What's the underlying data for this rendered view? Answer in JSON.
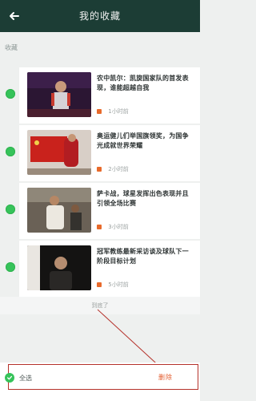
{
  "header": {
    "title": "我的收藏"
  },
  "edit_label": "收藏",
  "items": [
    {
      "text": "农中凯尔：凯旋国家队的首发表现，谁能超越自我",
      "meta": "1小时前"
    },
    {
      "text": "奥运健儿们举国旗领奖，为国争光成就世界荣耀",
      "meta": "2小时前"
    },
    {
      "text": "萨卡战，球星发挥出色表现并且引领全场比赛",
      "meta": "3小时前"
    },
    {
      "text": "冠军教练最新采访谈及球队下一阶段目标计划",
      "meta": "5小时前"
    }
  ],
  "list_end": "到底了",
  "bottom_bar": {
    "select_all_label": "全选",
    "delete_label": "删除"
  }
}
